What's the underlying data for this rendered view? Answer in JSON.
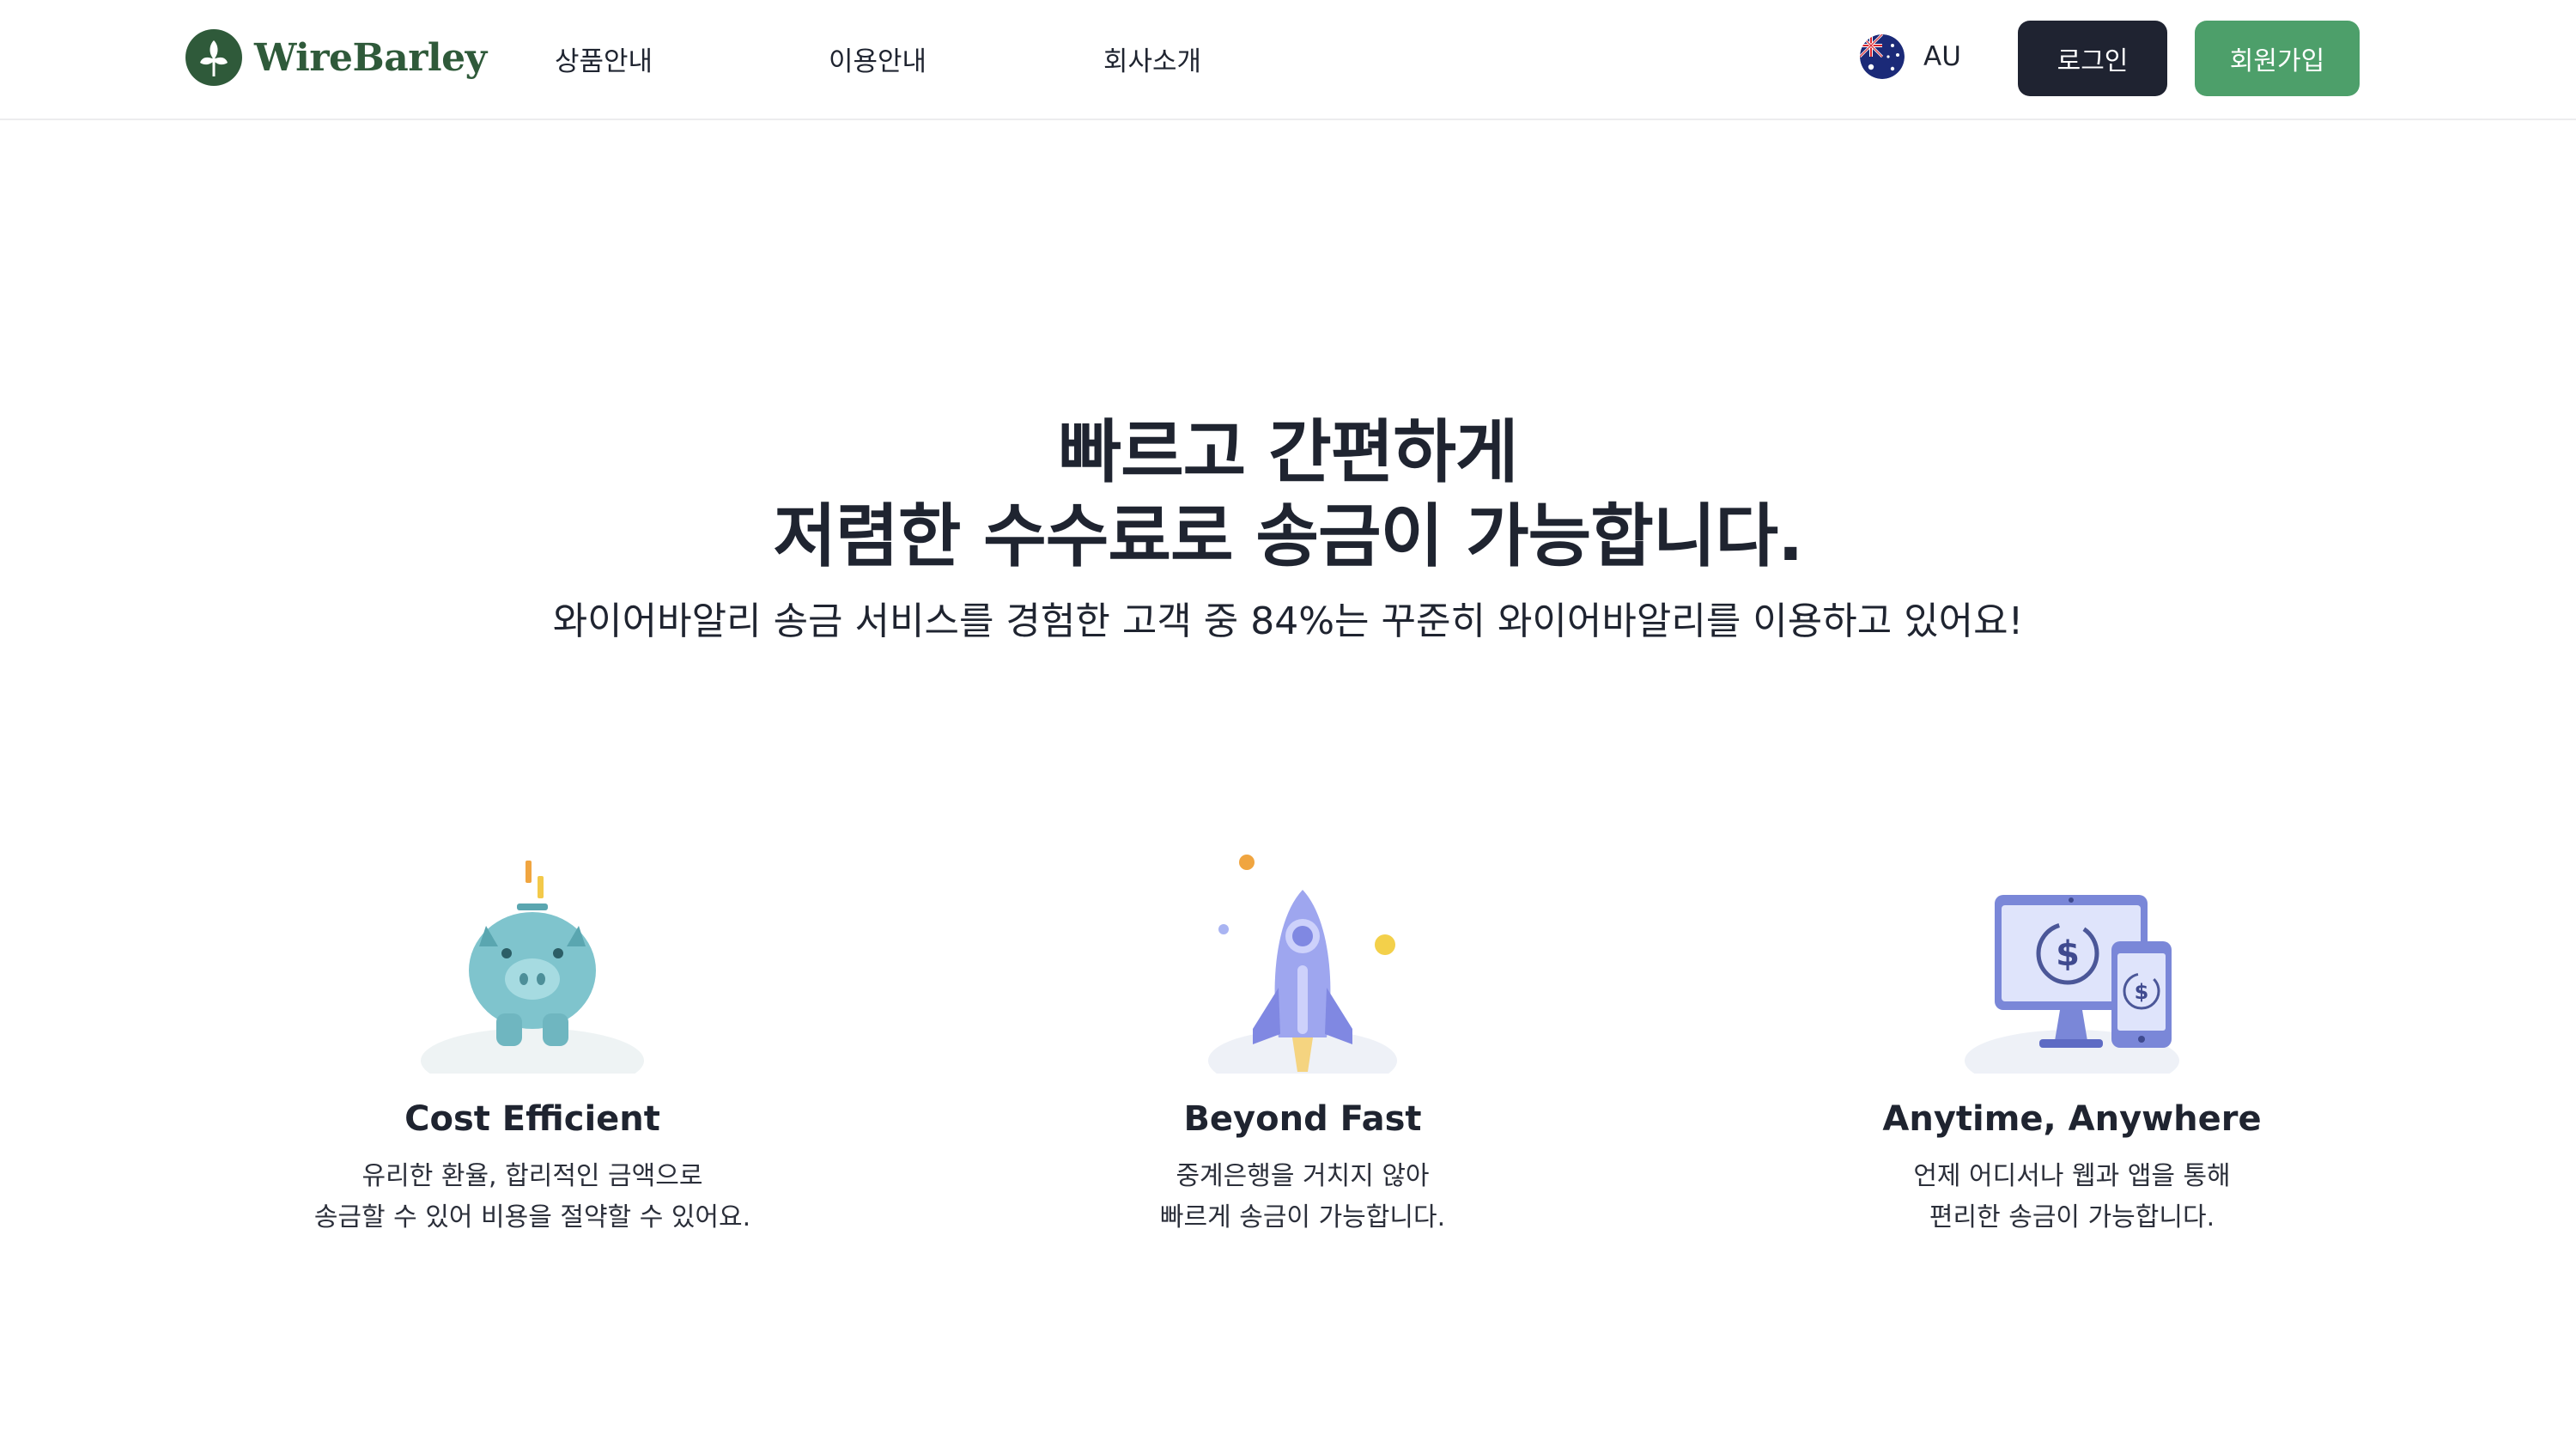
{
  "header": {
    "logo_text": "WireBarley",
    "nav": [
      "상품안내",
      "이용안내",
      "회사소개"
    ],
    "region": {
      "label": "AU",
      "flag_icon": "australia-flag-icon"
    },
    "login_label": "로그인",
    "signup_label": "회원가입"
  },
  "hero": {
    "title_line1": "빠르고 간편하게",
    "title_line2": "저렴한 수수료로 송금이 가능합니다.",
    "subtitle": "와이어바알리 송금 서비스를 경험한 고객 중  84%는 꾸준히 와이어바알리를 이용하고 있어요!"
  },
  "features": [
    {
      "icon": "piggy-bank-icon",
      "title": "Cost Efficient",
      "desc_line1": "유리한 환율, 합리적인 금액으로",
      "desc_line2": "송금할 수 있어 비용을 절약할 수 있어요."
    },
    {
      "icon": "rocket-icon",
      "title": "Beyond Fast",
      "desc_line1": "중계은행을 거치지 않아",
      "desc_line2": "빠르게 송금이 가능합니다."
    },
    {
      "icon": "devices-exchange-icon",
      "title": "Anytime, Anywhere",
      "desc_line1": "언제 어디서나 웹과 앱을 통해",
      "desc_line2": "편리한 송금이 가능합니다."
    }
  ],
  "colors": {
    "brand_green": "#2f5a3a",
    "signup_green": "#4d9f6a",
    "login_dark": "#1f2331",
    "text": "#1f2430"
  }
}
